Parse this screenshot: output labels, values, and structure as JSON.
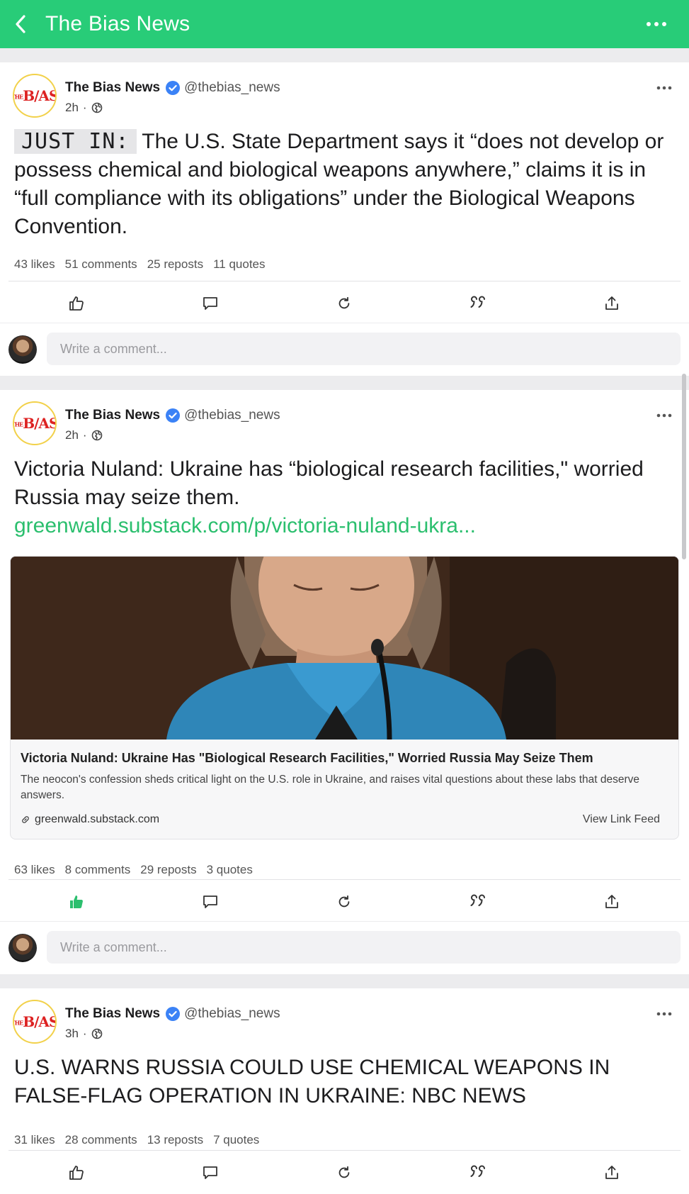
{
  "header": {
    "title": "The Bias News",
    "bg_color": "#28cc78"
  },
  "composer": {
    "placeholder": "Write a comment..."
  },
  "posts": [
    {
      "author": "The Bias News",
      "handle": "@thebias_news",
      "time": "2h",
      "tag": "JUST IN:",
      "text": "The U.S. State Department says it “does not develop or possess chemical and biological weapons anywhere,” claims it is in “full compliance with its obligations” under the Biological Weapons Convention.",
      "stats": {
        "likes": "43 likes",
        "comments": "51 comments",
        "reposts": "25 reposts",
        "quotes": "11 quotes"
      },
      "liked": false
    },
    {
      "author": "The Bias News",
      "handle": "@thebias_news",
      "time": "2h",
      "text": "Victoria Nuland: Ukraine has “biological research facilities,\" worried Russia may seize them.",
      "link": "greenwald.substack.com/p/victoria-nuland-ukra...",
      "card": {
        "title": "Victoria Nuland: Ukraine Has \"Biological Research Facilities,\" Worried Russia May Seize Them",
        "description": "The neocon's confession sheds critical light on the U.S. role in Ukraine, and raises vital questions about these labs that deserve answers.",
        "domain": "greenwald.substack.com",
        "feed_label": "View Link Feed"
      },
      "stats": {
        "likes": "63 likes",
        "comments": "8 comments",
        "reposts": "29 reposts",
        "quotes": "3 quotes"
      },
      "liked": true
    },
    {
      "author": "The Bias News",
      "handle": "@thebias_news",
      "time": "3h",
      "text": "U.S. WARNS RUSSIA COULD USE CHEMICAL WEAPONS IN FALSE-FLAG OPERATION IN UKRAINE: NBC NEWS",
      "stats": {
        "likes": "31 likes",
        "comments": "28 comments",
        "reposts": "13 reposts",
        "quotes": "7 quotes"
      },
      "liked": false
    }
  ],
  "colors": {
    "accent": "#2bbf6e",
    "verified": "#3b82f6"
  }
}
